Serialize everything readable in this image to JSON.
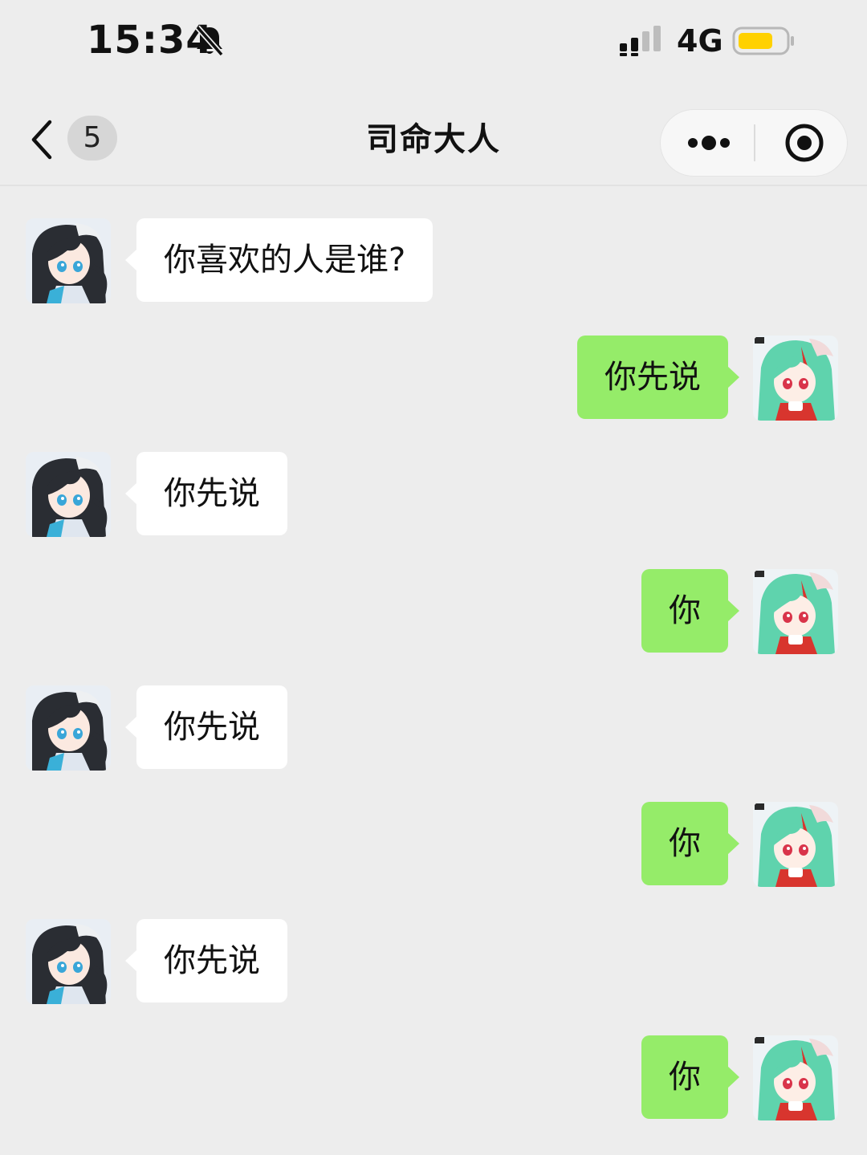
{
  "status_bar": {
    "time": "15:34",
    "network": "4G",
    "icons": [
      "bell-slash-icon",
      "signal-icon",
      "battery-icon"
    ],
    "battery_color": "#ffd100"
  },
  "nav": {
    "unread_count": "5",
    "title": "司命大人",
    "icons": [
      "back-chevron-icon",
      "more-dots-icon",
      "target-icon"
    ]
  },
  "colors": {
    "background": "#ededed",
    "incoming_bubble": "#ffffff",
    "outgoing_bubble": "#95ec69"
  },
  "messages": [
    {
      "sender": "contact",
      "text": "你喜欢的人是谁?"
    },
    {
      "sender": "me",
      "text": "你先说"
    },
    {
      "sender": "contact",
      "text": "你先说"
    },
    {
      "sender": "me",
      "text": "你"
    },
    {
      "sender": "contact",
      "text": "你先说"
    },
    {
      "sender": "me",
      "text": "你"
    },
    {
      "sender": "contact",
      "text": "你先说"
    },
    {
      "sender": "me",
      "text": "你"
    }
  ]
}
